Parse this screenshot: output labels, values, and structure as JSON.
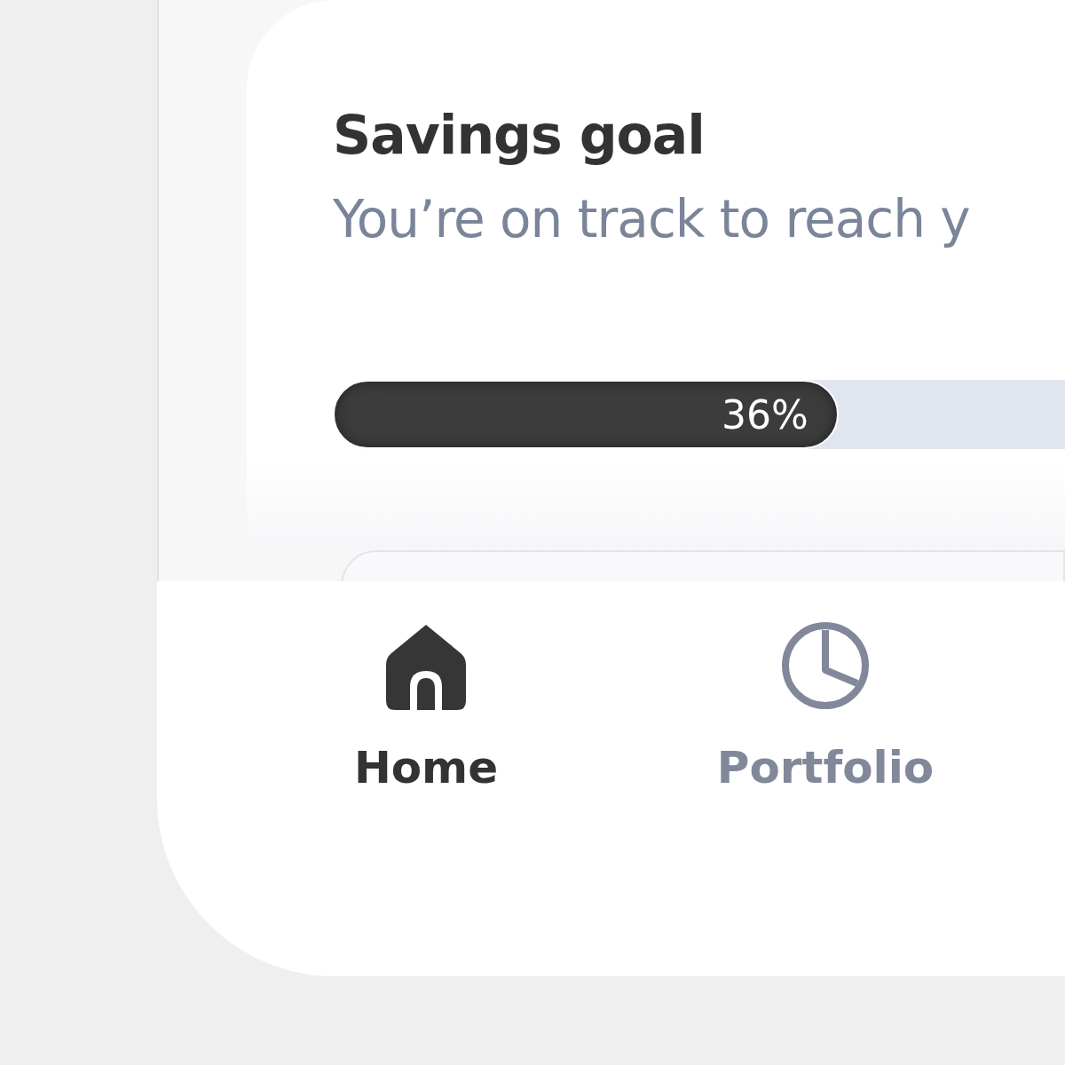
{
  "savings_goal": {
    "title": "Savings goal",
    "subtitle": "You’re on track to reach y",
    "progress": {
      "level": 0.36,
      "label": "36%"
    }
  },
  "tab_bar": {
    "items": [
      {
        "label": "Home",
        "kind": "home",
        "selected": true
      },
      {
        "label": "Portfolio",
        "kind": "pie",
        "selected": false
      }
    ]
  }
}
